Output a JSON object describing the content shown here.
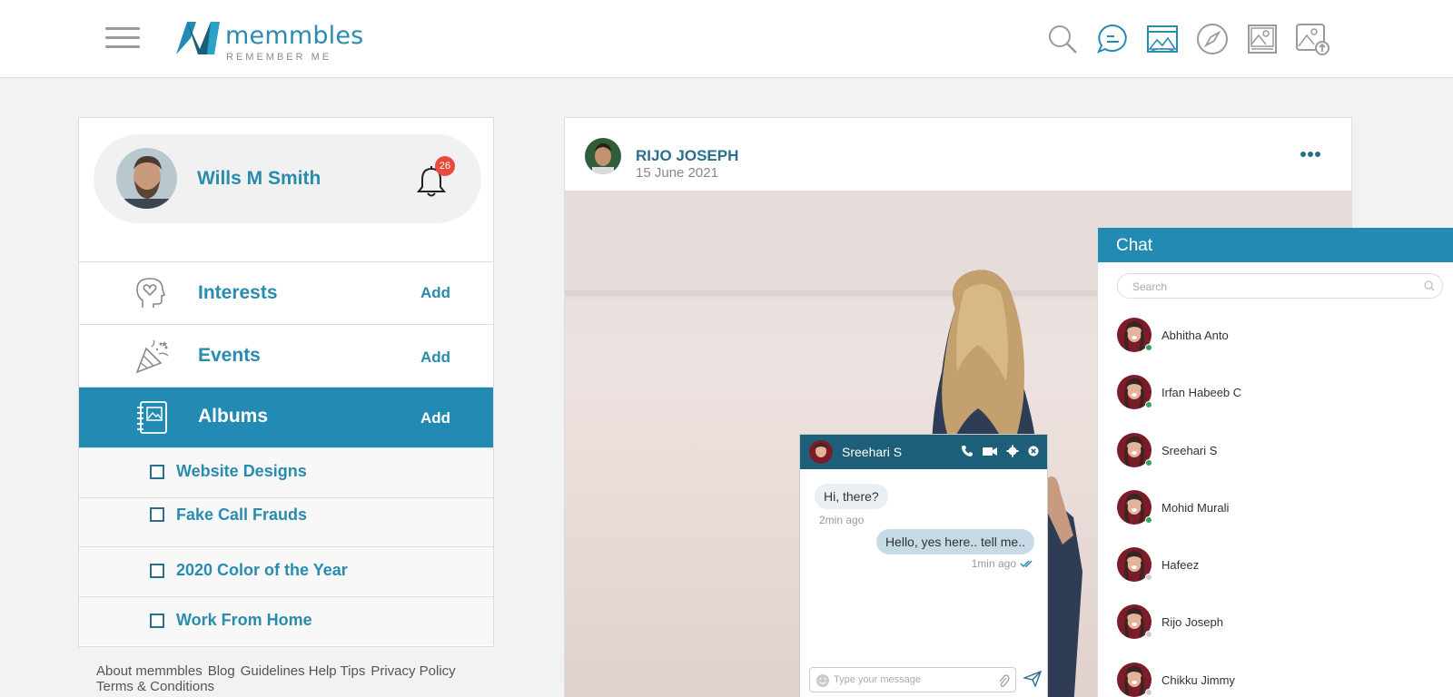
{
  "brand": {
    "name": "memmbles",
    "tagline": "REMEMBER ME",
    "primary_color": "#238bb3",
    "dark_color": "#1d5e78"
  },
  "header": {
    "icons": [
      "search-icon",
      "chat-bubble-icon",
      "gallery-icon",
      "compass-icon",
      "photo-album-icon",
      "upload-photo-icon"
    ]
  },
  "profile": {
    "name": "Wills M Smith",
    "notification_count": "26"
  },
  "menu": {
    "interests": {
      "label": "Interests",
      "action": "Add"
    },
    "events": {
      "label": "Events",
      "action": "Add"
    },
    "albums": {
      "label": "Albums",
      "action": "Add"
    }
  },
  "albums": [
    "Website Designs",
    "Fake Call Frauds",
    "2020 Color of the Year",
    "Work From Home"
  ],
  "footer": {
    "links": [
      "About memmbles",
      "Blog",
      "Guidelines Help Tips",
      "Privacy Policy",
      "Terms & Conditions"
    ]
  },
  "post": {
    "author": "RIJO JOSEPH",
    "date": "15 June 2021"
  },
  "chat_window": {
    "contact": "Sreehari S",
    "messages": [
      {
        "direction": "in",
        "text": "Hi, there?",
        "time": "2min ago"
      },
      {
        "direction": "out",
        "text": "Hello,  yes here.. tell me..",
        "time": "1min ago"
      }
    ],
    "input_placeholder": "Type your message"
  },
  "chat_panel": {
    "title": "Chat",
    "search_placeholder": "Search",
    "contacts": [
      {
        "name": "Abhitha Anto",
        "status": "online",
        "status_color": "#2fa84f"
      },
      {
        "name": "Irfan Habeeb C",
        "status": "online",
        "status_color": "#2fa84f"
      },
      {
        "name": "Sreehari S",
        "status": "online",
        "status_color": "#2fa84f"
      },
      {
        "name": "Mohid Murali",
        "status": "online",
        "status_color": "#2fa84f"
      },
      {
        "name": "Hafeez",
        "status": "offline",
        "status_color": "#cccccc"
      },
      {
        "name": "Rijo Joseph",
        "status": "offline",
        "status_color": "#cccccc"
      },
      {
        "name": "Chikku Jimmy",
        "status": "offline",
        "status_color": "#cccccc"
      }
    ]
  }
}
